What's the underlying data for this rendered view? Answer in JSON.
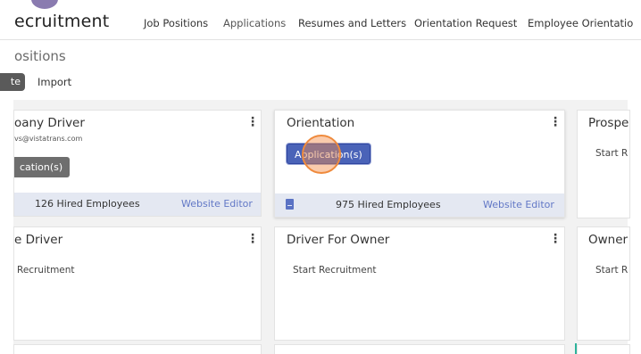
{
  "brand": {
    "text": "ecruitment"
  },
  "nav": {
    "items": [
      {
        "label": "Job Positions"
      },
      {
        "label": "Applications"
      },
      {
        "label": "Resumes and Letters"
      },
      {
        "label": "Orientation Request"
      },
      {
        "label": "Employee Orientatio"
      }
    ]
  },
  "page": {
    "title": "ositions",
    "create_label": "te",
    "import_label": "Import"
  },
  "cards": [
    {
      "title": "oany Driver",
      "email": "vs@vistatrans.com",
      "button": "cation(s)",
      "hired": "126 Hired Employees",
      "editor": "Website Editor"
    },
    {
      "title": "Orientation",
      "button": "Application(s)",
      "hired": "975 Hired Employees",
      "editor": "Website Editor"
    },
    {
      "title": "Prospe",
      "start": "Start R"
    },
    {
      "title": "e Driver",
      "start": "Recruitment"
    },
    {
      "title": "Driver For Owner",
      "start": "Start Recruitment"
    },
    {
      "title": "Owner",
      "start": "Start R"
    }
  ],
  "colors": {
    "accent": "#4a63b8",
    "link": "#6278c6",
    "footer_bg": "#e4e8f2",
    "cursor": "#ef8a3c"
  }
}
